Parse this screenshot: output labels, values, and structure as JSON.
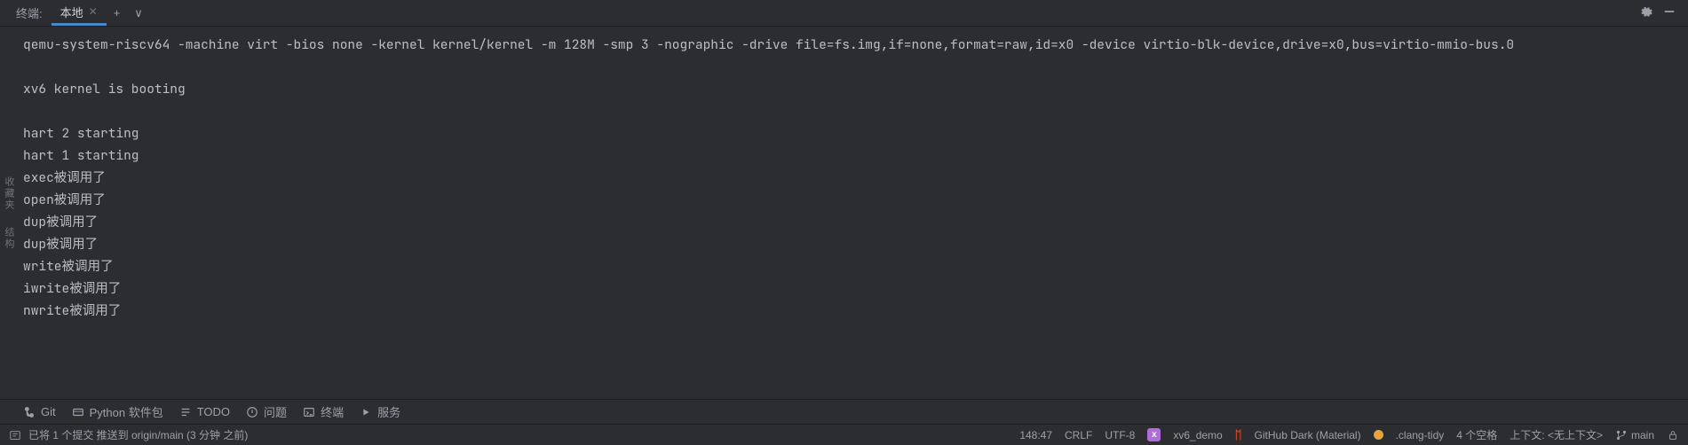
{
  "tabbar": {
    "title": "终端:",
    "tab_label": "本地",
    "add": "+",
    "dropdown": "∨"
  },
  "terminal": {
    "lines": [
      "qemu-system-riscv64 -machine virt -bios none -kernel kernel/kernel -m 128M -smp 3 -nographic -drive file=fs.img,if=none,format=raw,id=x0 -device virtio-blk-device,drive=x0,bus=virtio-mmio-bus.0",
      "",
      "xv6 kernel is booting",
      "",
      "hart 2 starting",
      "hart 1 starting",
      "exec被调用了",
      "open被调用了",
      "dup被调用了",
      "dup被调用了",
      "write被调用了",
      "iwrite被调用了",
      "nwrite被调用了"
    ]
  },
  "gutter": {
    "label1": "收藏夹",
    "label2": "结构"
  },
  "toolbar": {
    "git": "Git",
    "python": "Python 软件包",
    "todo": "TODO",
    "problems": "问题",
    "terminal": "终端",
    "services": "服务"
  },
  "status": {
    "commit": "已将 1 个提交 推送到 origin/main (3 分钟 之前)",
    "pos": "148:47",
    "eol": "CRLF",
    "enc": "UTF-8",
    "project": "xv6_demo",
    "theme": "GitHub Dark (Material)",
    "tidy": ".clang-tidy",
    "indent": "4 个空格",
    "context": "上下文: <无上下文>",
    "branch": "main"
  }
}
